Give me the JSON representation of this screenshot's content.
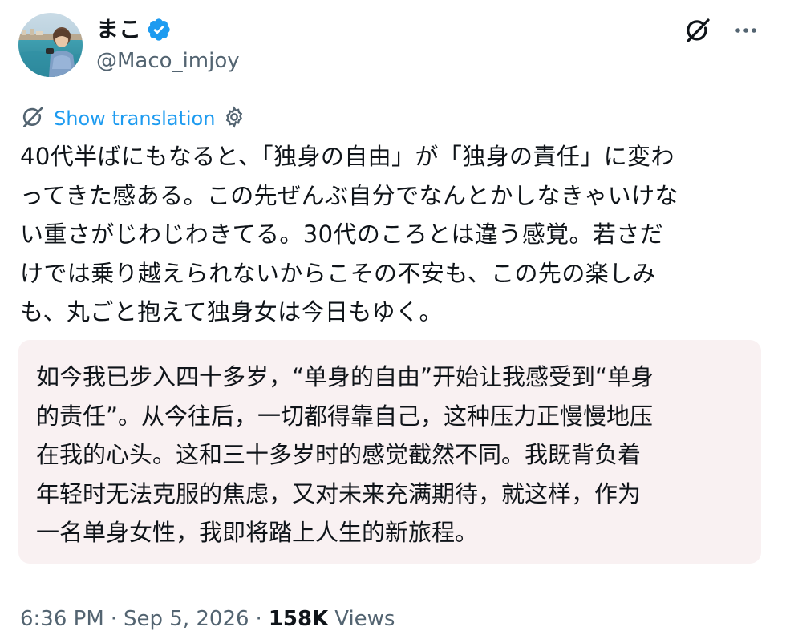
{
  "tweet": {
    "author": {
      "display_name": "まこ",
      "handle": "@Maco_imjoy",
      "verified": true,
      "avatar_icon": "profile-photo-seaside"
    },
    "actions": {
      "grok_icon": "grok-icon",
      "more_icon": "more-icon"
    },
    "translation": {
      "label": "Show translation",
      "translate_icon": "grok-icon",
      "settings_icon": "gear-icon"
    },
    "text_lines": [
      "40代半ばにもなると、「独身の自由」が「独身の責任」に変わ",
      "ってきた感ある。この先ぜんぶ自分でなんとかしなきゃいけな",
      "い重さがじわじわきてる。30代のころとは違う感覚。若さだ",
      "けでは乗り越えられないからこその不安も、この先の楽しみ",
      "も、丸ごと抱えて独身女は今日もゆく。"
    ],
    "translated_lines": [
      "如今我已步入四十多岁，“单身的自由”开始让我感受到“单身",
      "的责任”。从今往后，一切都得靠自己，这种压力正慢慢地压",
      "在我的心头。这和三十多岁时的感觉截然不同。我既背负着",
      "年轻时无法克服的焦虑，又对未来充满期待，就这样，作为",
      "一名单身女性，我即将踏上人生的新旅程。"
    ],
    "meta": {
      "time": "6:36 PM",
      "separator": "·",
      "date": "Sep 5, 2026",
      "views_count": "158K",
      "views_label": "Views"
    },
    "colors": {
      "accent": "#1d9bf0",
      "text": "#0f1419",
      "secondary": "#536471",
      "translation_bg": "#f9f1f2"
    }
  }
}
